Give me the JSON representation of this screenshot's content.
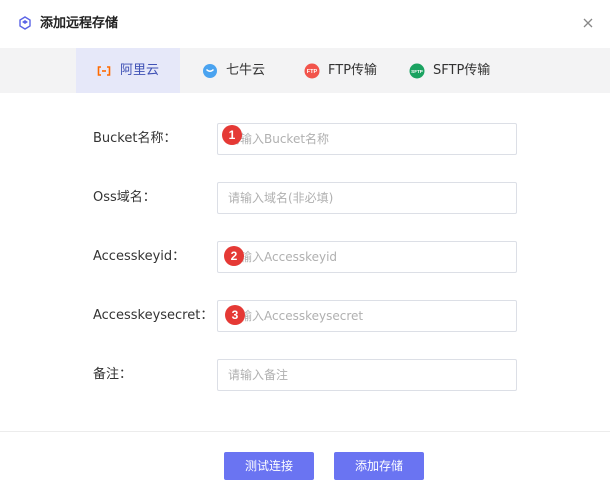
{
  "dialog": {
    "title": "添加远程存储",
    "close_icon": "close-icon",
    "title_icon": "storage-icon"
  },
  "tabs": [
    {
      "label": "阿里云",
      "icon": "aliyun-icon",
      "active": true,
      "icon_color": "#ff6a00"
    },
    {
      "label": "七牛云",
      "icon": "qiniu-icon",
      "active": false,
      "icon_color": "#4aa3f0"
    },
    {
      "label": "FTP传输",
      "icon": "ftp-icon",
      "active": false,
      "icon_color": "#f2544b"
    },
    {
      "label": "SFTP传输",
      "icon": "sftp-icon",
      "active": false,
      "icon_color": "#1aa260"
    }
  ],
  "form": {
    "fields": [
      {
        "label": "Bucket名称：",
        "placeholder": "请输入Bucket名称",
        "value": "",
        "marker": "1"
      },
      {
        "label": "Oss域名：",
        "placeholder": "请输入域名(非必填)",
        "value": "",
        "marker": ""
      },
      {
        "label": "Accesskeyid：",
        "placeholder": "请输入Accesskeyid",
        "value": "",
        "marker": "2"
      },
      {
        "label": "Accesskeysecret：",
        "placeholder": "请输入Accesskeysecret",
        "value": "",
        "marker": "3"
      },
      {
        "label": "备注：",
        "placeholder": "请输入备注",
        "value": "",
        "marker": ""
      }
    ]
  },
  "footer": {
    "test_label": "测试连接",
    "add_label": "添加存储"
  },
  "colors": {
    "accent": "#6a74f2",
    "active_tab_bg": "#e6e8f9",
    "marker": "#e53935"
  }
}
